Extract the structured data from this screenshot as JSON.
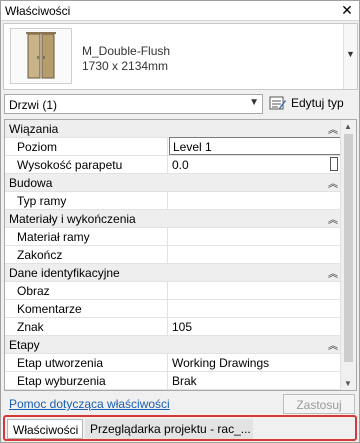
{
  "titlebar": {
    "title": "Właściwości",
    "close_icon": "close-icon"
  },
  "type_selector": {
    "family_name": "M_Double-Flush",
    "size": "1730 x 2134mm"
  },
  "instance": {
    "selected": "Drzwi (1)",
    "edit_type_label": "Edytuj typ"
  },
  "groups": {
    "wiazania": "Wiązania",
    "budowa": "Budowa",
    "materialy": "Materiały i wykończenia",
    "dane": "Dane identyfikacyjne",
    "etapy": "Etapy"
  },
  "props": {
    "poziom": {
      "name": "Poziom",
      "value": "Level 1"
    },
    "parapet": {
      "name": "Wysokość parapetu",
      "value": "0.0"
    },
    "typ_ramy": {
      "name": "Typ ramy",
      "value": ""
    },
    "material_ramy": {
      "name": "Materiał ramy",
      "value": ""
    },
    "zakoncz": {
      "name": "Zakończ",
      "value": ""
    },
    "obraz": {
      "name": "Obraz",
      "value": ""
    },
    "komentarze": {
      "name": "Komentarze",
      "value": ""
    },
    "znak": {
      "name": "Znak",
      "value": "105"
    },
    "etap_utw": {
      "name": "Etap utworzenia",
      "value": "Working Drawings"
    },
    "etap_wyb": {
      "name": "Etap wyburzenia",
      "value": "Brak"
    }
  },
  "footer": {
    "help_link": "Pomoc dotycząca właściwości",
    "apply_label": "Zastosuj"
  },
  "tabs": {
    "active": "Właściwości",
    "inactive": "Przeglądarka projektu - rac_..."
  },
  "colors": {
    "link": "#1a5fb4",
    "highlight_border": "#d43a3a"
  }
}
